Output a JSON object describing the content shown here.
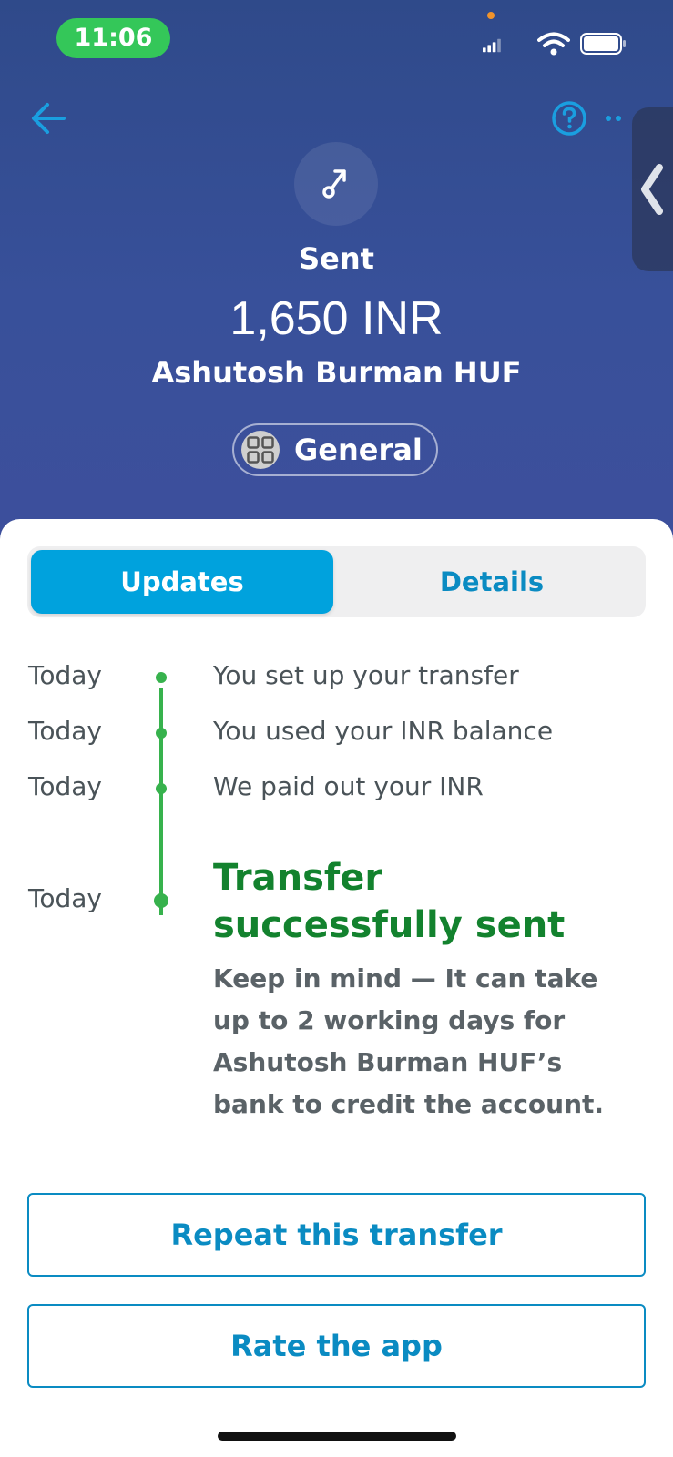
{
  "status_bar": {
    "time": "11:06"
  },
  "header": {
    "status": "Sent",
    "amount": "1,650 INR",
    "recipient": "Ashutosh Burman HUF",
    "category": "General"
  },
  "tabs": [
    {
      "label": "Updates",
      "active": true
    },
    {
      "label": "Details",
      "active": false
    }
  ],
  "timeline": [
    {
      "date": "Today",
      "text": "You set up your transfer"
    },
    {
      "date": "Today",
      "text": "You used your INR balance"
    },
    {
      "date": "Today",
      "text": "We paid out your INR"
    },
    {
      "date": "Today",
      "title": "Transfer successfully sent",
      "note": "Keep in mind — It can take up to 2 working days for Ashutosh Burman HUF’s bank to credit the account."
    }
  ],
  "actions": {
    "repeat_label": "Repeat this transfer",
    "rate_label": "Rate the app"
  },
  "colors": {
    "accent": "#00a2dd",
    "link": "#0a8bc2",
    "success": "#13822e",
    "timeline": "#37b24d",
    "header_bg": "#38509a"
  },
  "icons": {
    "back": "arrow-left-icon",
    "help": "question-circle-icon",
    "more": "more-dots-icon",
    "type": "sent-arrow-icon",
    "category": "grid-icon"
  }
}
